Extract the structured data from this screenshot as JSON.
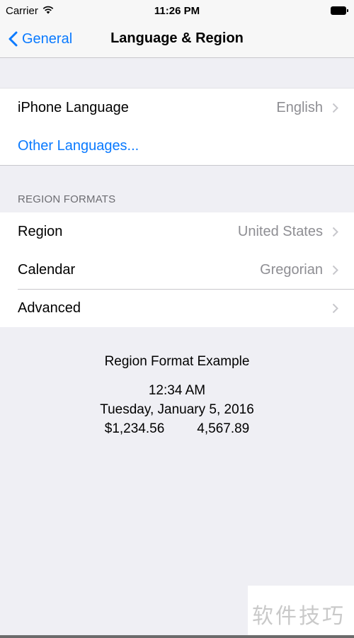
{
  "status_bar": {
    "carrier": "Carrier",
    "time": "11:26 PM"
  },
  "nav": {
    "back_label": "General",
    "title": "Language & Region"
  },
  "language_group": {
    "iphone_language_label": "iPhone Language",
    "iphone_language_value": "English",
    "other_languages_label": "Other Languages..."
  },
  "region_formats": {
    "header": "REGION FORMATS",
    "region_label": "Region",
    "region_value": "United States",
    "calendar_label": "Calendar",
    "calendar_value": "Gregorian",
    "advanced_label": "Advanced"
  },
  "example": {
    "title": "Region Format Example",
    "time": "12:34 AM",
    "date": "Tuesday, January 5, 2016",
    "currency": "$1,234.56",
    "number": "4,567.89"
  },
  "watermark": "软件技巧",
  "colors": {
    "accent": "#0a7aff",
    "secondary_text": "#8e8e93",
    "background": "#efeff4"
  }
}
